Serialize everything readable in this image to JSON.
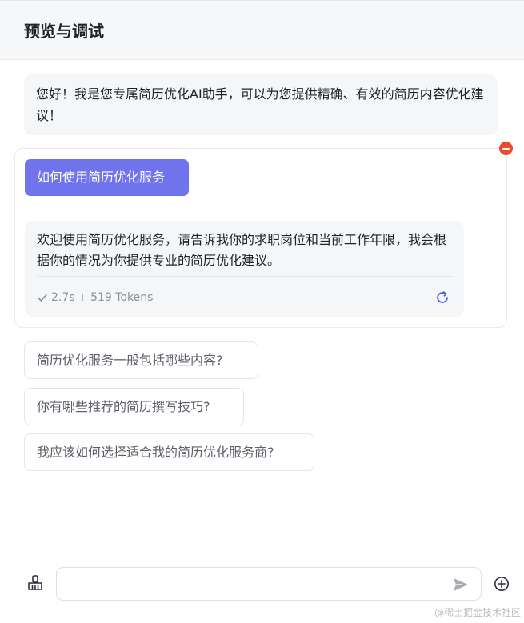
{
  "header": {
    "title": "预览与调试"
  },
  "welcome": {
    "text": "您好！我是您专属简历优化AI助手，可以为您提供精确、有效的简历内容优化建议！"
  },
  "qa": {
    "question": "如何使用简历优化服务",
    "answer": "欢迎使用简历优化服务，请告诉我你的求职岗位和当前工作年限，我会根据你的情况为你提供专业的简历优化建议。",
    "meta": {
      "time": "2.7s",
      "separator": "I",
      "tokens": "519 Tokens"
    }
  },
  "suggestions": [
    "简历优化服务一般包括哪些内容?",
    "你有哪些推荐的简历撰写技巧?",
    "我应该如何选择适合我的简历优化服务商?"
  ],
  "input": {
    "value": "",
    "placeholder": ""
  },
  "watermark": "@稀土掘金技术社区",
  "colors": {
    "accent": "#6f73ec",
    "remove": "#ee4a2e",
    "refresh": "#4f5bd5",
    "header_bg": "#f6f7f9"
  },
  "icons": {
    "remove": "remove-icon",
    "check": "check-icon",
    "refresh": "refresh-icon",
    "clear": "broom-icon",
    "send": "send-icon",
    "add": "plus-circle-icon"
  }
}
